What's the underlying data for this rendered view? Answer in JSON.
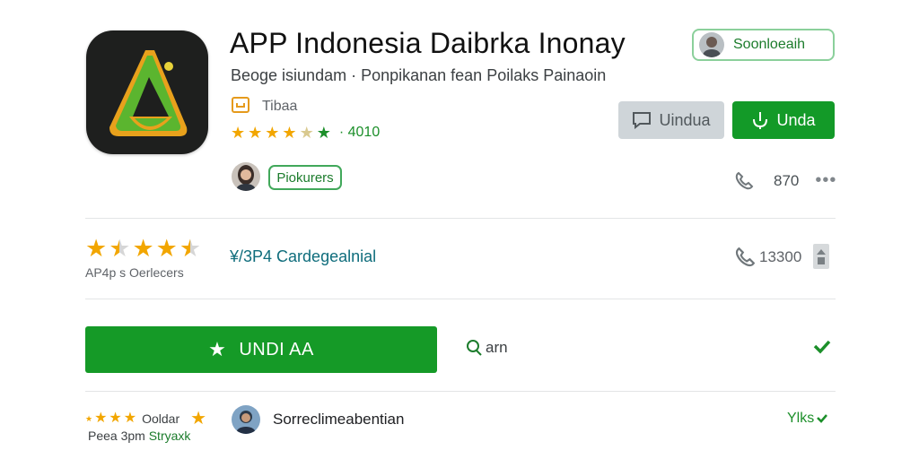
{
  "app": {
    "title": "APP Indonesia Daibrka Inonay",
    "subtitle": "Beoge isiundam · Ponpikanan fean Poilaks Painaoin",
    "developer": "Tibaa",
    "rating_text": "· 4010"
  },
  "header_chip": {
    "label": "Soonloeaih"
  },
  "buttons": {
    "secondary_label": "Uindua",
    "primary_label": "Unda",
    "big_label": "UNDI AA"
  },
  "profile": {
    "chip_label": "Piokurers",
    "count": "870"
  },
  "rating_section": {
    "caption": "AP4p s Oerlecers",
    "link": "¥/3P4 Cardegealnial",
    "count": "13300"
  },
  "action_row": {
    "link_label": "arn"
  },
  "bottom": {
    "left_top": "Ooldar",
    "left_bottom": "Peea 3pm",
    "left_bottom_green": "Stryaxk",
    "user_name": "Sorreclimeabentian",
    "right_label": "Ylks"
  },
  "colors": {
    "accent": "#139a28",
    "star": "#f2a600",
    "teal": "#0f6d7c"
  }
}
